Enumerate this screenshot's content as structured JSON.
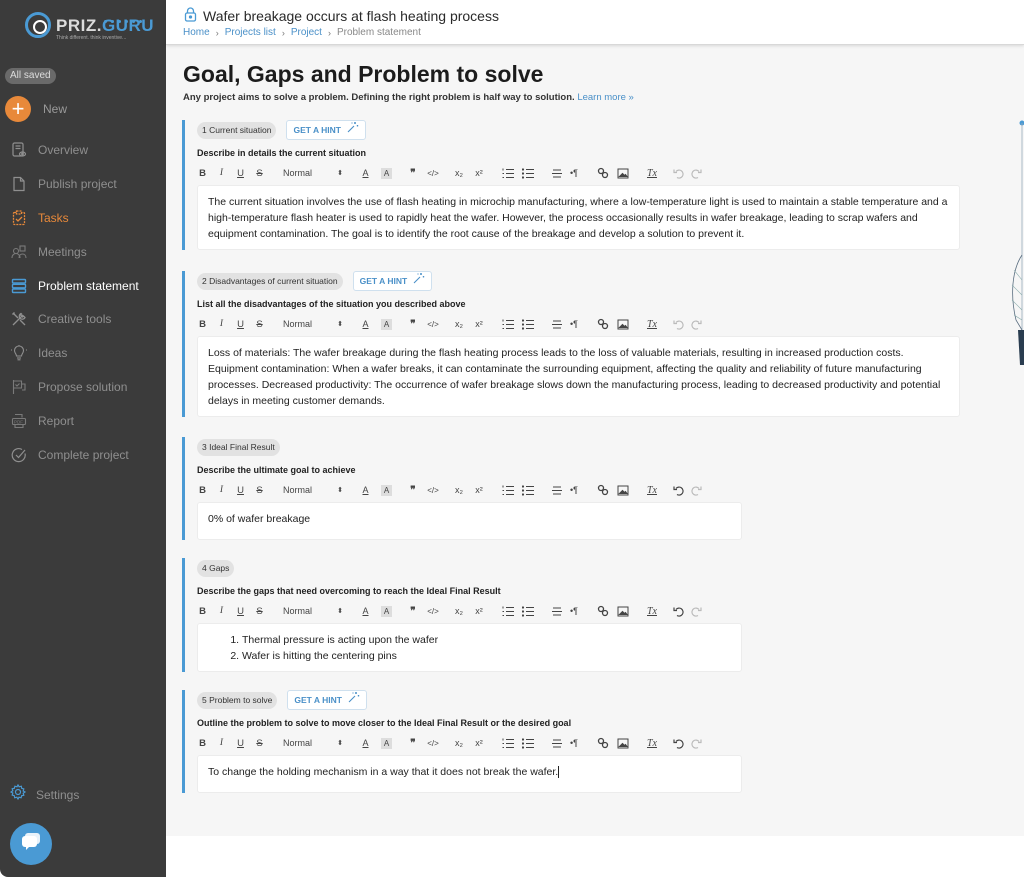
{
  "sidebar": {
    "logo": {
      "brand_main": "PRIZ.",
      "brand_accent": "GURU",
      "tagline": "Think different. think inventive..."
    },
    "saved_status": "All saved",
    "new_label": "New",
    "items": [
      {
        "label": "Overview",
        "icon": "overview-icon"
      },
      {
        "label": "Publish project",
        "icon": "document-icon"
      },
      {
        "label": "Tasks",
        "icon": "clipboard-check-icon"
      },
      {
        "label": "Meetings",
        "icon": "people-icon"
      },
      {
        "label": "Problem statement",
        "icon": "stack-icon"
      },
      {
        "label": "Creative tools",
        "icon": "tools-icon"
      },
      {
        "label": "Ideas",
        "icon": "lightbulb-icon"
      },
      {
        "label": "Propose solution",
        "icon": "flag-icon"
      },
      {
        "label": "Report",
        "icon": "pdf-icon"
      },
      {
        "label": "Complete project",
        "icon": "check-circle-icon"
      }
    ],
    "settings_label": "Settings"
  },
  "header": {
    "title": "Wafer breakage occurs at flash heating process",
    "breadcrumb": [
      "Home",
      "Projects list",
      "Project",
      "Problem statement"
    ]
  },
  "main": {
    "title": "Goal, Gaps and Problem to solve",
    "subtitle": "Any project aims to solve a problem. Defining the right problem is half way to solution.",
    "learn_more": "Learn more »",
    "toolbar": {
      "bold": "B",
      "italic": "I",
      "underline": "U",
      "strike": "S",
      "format_select": "Normal",
      "color": "A",
      "background": "A",
      "quote": "❞",
      "code": "</>",
      "sub": "x₂",
      "sup": "x²",
      "align": "≡",
      "direction": "•¶",
      "clear": "Tx"
    },
    "hint_label": "GET A HINT",
    "sections": [
      {
        "pill": "1 Current situation",
        "has_hint": true,
        "label": "Describe in details the current situation",
        "content": "The current situation involves the use of flash heating in microchip manufacturing, where a low-temperature light is used to maintain a stable temperature and a high-temperature flash heater is used to rapidly heat the wafer. However, the process occasionally results in wafer breakage, leading to scrap wafers and equipment contamination. The goal is to identify the root cause of the breakage and develop a solution to prevent it."
      },
      {
        "pill": "2 Disadvantages of current situation",
        "has_hint": true,
        "label": "List all the disadvantages of the situation you described above",
        "content": "Loss of materials: The wafer breakage during the flash heating process leads to the loss of valuable materials, resulting in increased production costs. Equipment contamination: When a wafer breaks, it can contaminate the surrounding equipment, affecting the quality and reliability of future manufacturing processes. Decreased productivity: The occurrence of wafer breakage slows down the manufacturing process, leading to decreased productivity and potential delays in meeting customer demands."
      },
      {
        "pill": "3 Ideal Final Result",
        "has_hint": false,
        "label": "Describe the ultimate goal to achieve",
        "content": "0% of wafer breakage"
      },
      {
        "pill": "4 Gaps",
        "has_hint": false,
        "label": "Describe the gaps that need overcoming to reach the Ideal Final Result",
        "list": [
          "Thermal pressure is acting upon the wafer",
          "Wafer is hitting the centering pins"
        ]
      },
      {
        "pill": "5 Problem to solve",
        "has_hint": true,
        "label": "Outline the problem to solve to move closer to the Ideal Final Result or the desired goal",
        "content": "To change the holding mechanism in a way that it does not break the wafer."
      }
    ]
  },
  "colors": {
    "accent": "#4a9ad4",
    "orange": "#e8893a",
    "sidebar_bg": "#3b3b3b",
    "main_bg": "#f6f6f6"
  }
}
